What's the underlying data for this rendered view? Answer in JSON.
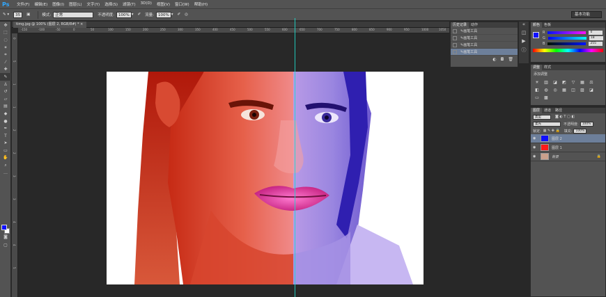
{
  "app": {
    "logo": "Ps"
  },
  "menu": [
    "文件(F)",
    "编辑(E)",
    "图像(I)",
    "图层(L)",
    "文字(Y)",
    "选择(S)",
    "滤镜(T)",
    "3D(D)",
    "视图(V)",
    "窗口(W)",
    "帮助(H)"
  ],
  "options": {
    "brush_size": "35",
    "mode_label": "模式:",
    "mode_value": "正常",
    "opacity_label": "不透明度:",
    "opacity_value": "100%",
    "flow_label": "流量:",
    "flow_value": "100%",
    "workspace": "基本功能"
  },
  "document": {
    "tab_title": "timg.jpg @ 100% (图层 2, RGB/8#) *",
    "ruler_h": [
      "-150",
      "-100",
      "-50",
      "0",
      "50",
      "100",
      "150",
      "200",
      "250",
      "300",
      "350",
      "400",
      "450",
      "500",
      "550",
      "600",
      "650",
      "700",
      "750",
      "800",
      "850",
      "900",
      "950",
      "1000",
      "1050"
    ],
    "ruler_v": [
      "0",
      "5",
      "1",
      "1",
      "2",
      "2",
      "3",
      "3",
      "4",
      "4",
      "5"
    ]
  },
  "history": {
    "tabs": [
      "历史记录",
      "动作"
    ],
    "items": [
      "画笔工具",
      "画笔工具",
      "画笔工具",
      "画笔工具"
    ]
  },
  "color_panel": {
    "tabs": [
      "颜色",
      "色板"
    ],
    "rows": [
      {
        "label": "R",
        "value": "0"
      },
      {
        "label": "G",
        "value": "18"
      },
      {
        "label": "B",
        "value": "255"
      }
    ],
    "fg": "#1010ff",
    "bg": "#ffffff"
  },
  "adjust_panel": {
    "tabs": [
      "调整",
      "样式"
    ],
    "title": "添加调整"
  },
  "layers_panel": {
    "tabs": [
      "图层",
      "通道",
      "路径"
    ],
    "kind_label": "类型",
    "blend_value": "柔光",
    "opacity_label": "不透明度:",
    "opacity_value": "100%",
    "lock_label": "锁定:",
    "fill_label": "填充:",
    "fill_value": "100%",
    "layers": [
      {
        "name": "图层 2",
        "color": "#1010ff",
        "selected": true
      },
      {
        "name": "图层 1",
        "color": "#ff1a1a",
        "selected": false
      },
      {
        "name": "背景",
        "color": "#c9a08c",
        "selected": false
      }
    ]
  },
  "colors": {
    "accent": "#31a8ff",
    "guide": "#1fd7c9",
    "selection": "#6d7f9a"
  }
}
